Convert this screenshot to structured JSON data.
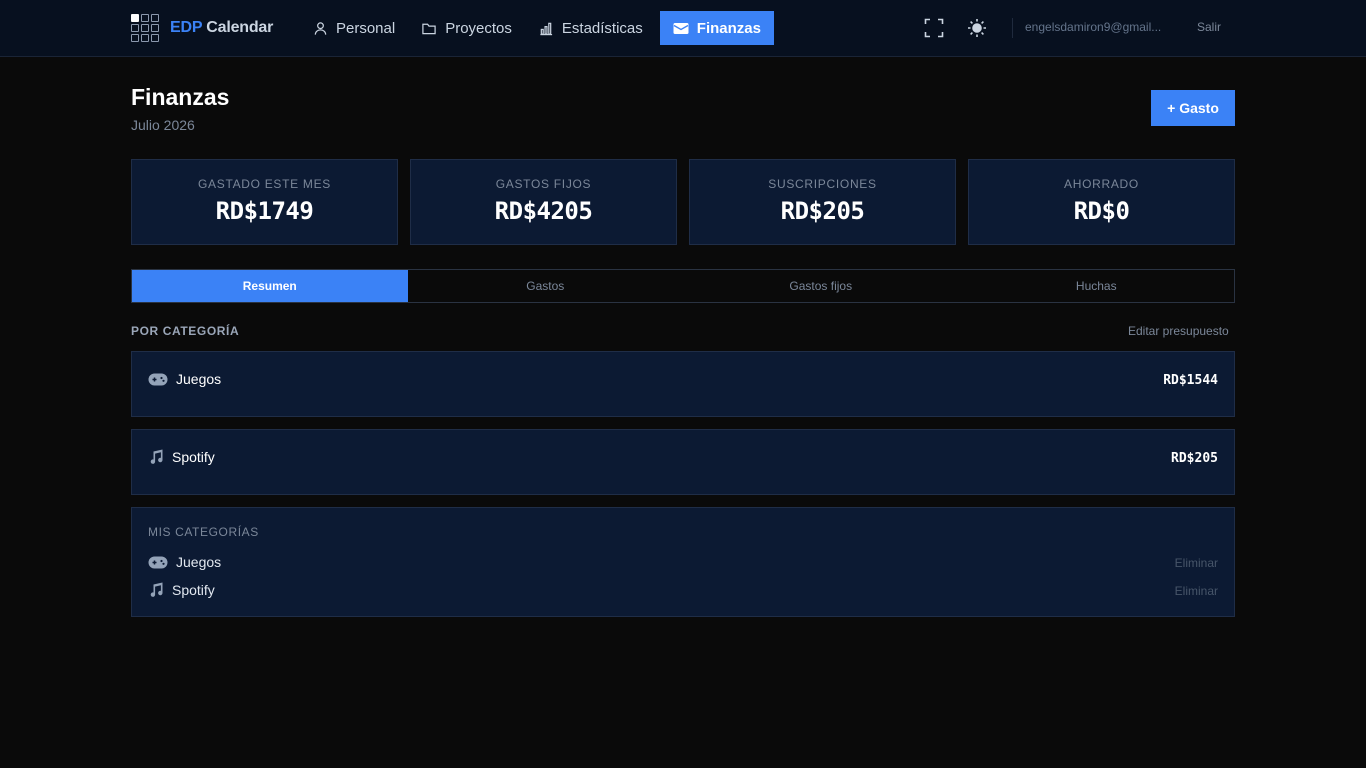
{
  "brand": {
    "accent": "EDP",
    "rest": "Calendar"
  },
  "nav": {
    "items": [
      {
        "label": "Personal",
        "icon": "person-icon"
      },
      {
        "label": "Proyectos",
        "icon": "folder-icon"
      },
      {
        "label": "Estadísticas",
        "icon": "bar-chart-icon"
      },
      {
        "label": "Finanzas",
        "icon": "wallet-icon",
        "active": true
      }
    ],
    "email": "engelsdamiron9@gmail...",
    "logout": "Salir"
  },
  "page": {
    "title": "Finanzas",
    "subtitle": "Julio 2026",
    "add_button": "+ Gasto"
  },
  "stats": [
    {
      "label": "GASTADO ESTE MES",
      "value": "RD$1749"
    },
    {
      "label": "GASTOS FIJOS",
      "value": "RD$4205"
    },
    {
      "label": "SUSCRIPCIONES",
      "value": "RD$205"
    },
    {
      "label": "AHORRADO",
      "value": "RD$0"
    }
  ],
  "tabs": [
    {
      "label": "Resumen",
      "active": true
    },
    {
      "label": "Gastos"
    },
    {
      "label": "Gastos fijos"
    },
    {
      "label": "Huchas"
    }
  ],
  "categories": {
    "title": "POR CATEGORÍA",
    "edit_link": "Editar presupuesto",
    "rows": [
      {
        "name": "Juegos",
        "icon": "gamepad-icon",
        "amount": "RD$1544"
      },
      {
        "name": "Spotify",
        "icon": "music-note-icon",
        "amount": "RD$205"
      }
    ]
  },
  "my_categories": {
    "title": "MIS CATEGORÍAS",
    "items": [
      {
        "name": "Juegos",
        "icon": "gamepad-icon",
        "action": "Eliminar"
      },
      {
        "name": "Spotify",
        "icon": "music-note-icon",
        "action": "Eliminar"
      }
    ]
  },
  "colors": {
    "accent": "#3b82f6",
    "background": "#0a0a0a",
    "card": "#0c1a33",
    "topbar": "#07101f"
  }
}
